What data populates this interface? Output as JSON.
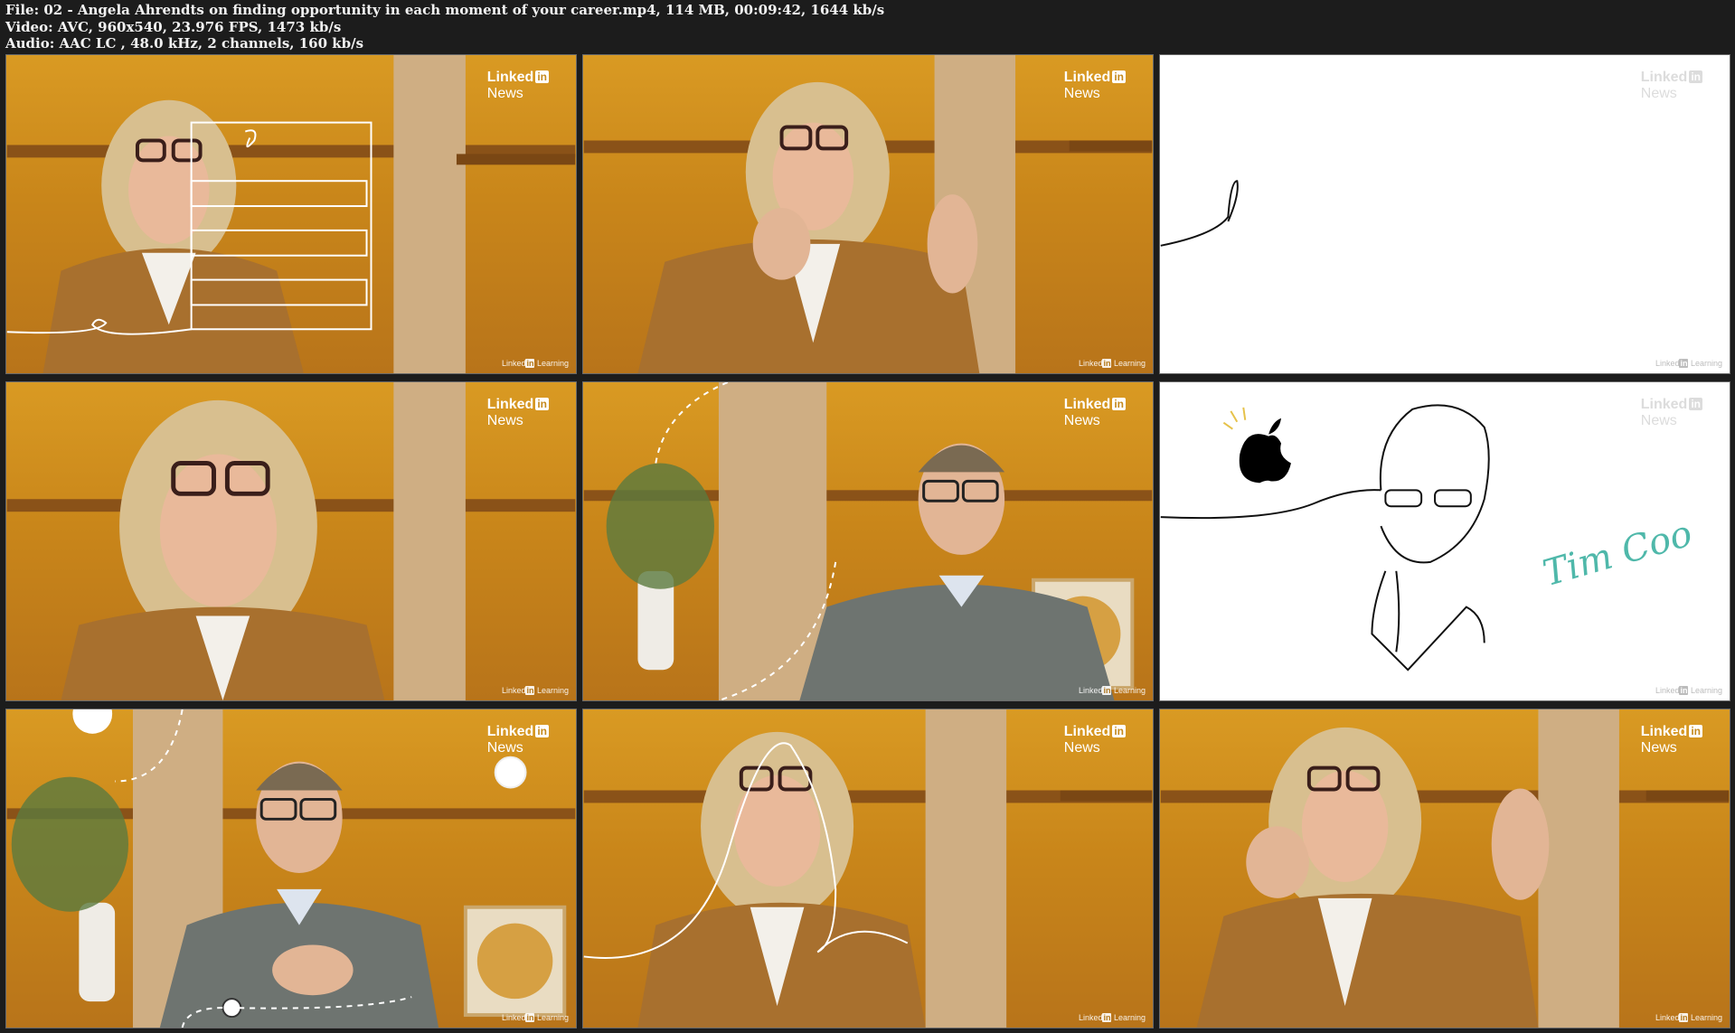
{
  "file_info": {
    "file_line": "File: 02 - Angela Ahrendts on finding opportunity in each moment of your career.mp4, 114 MB, 00:09:42, 1644 kb/s",
    "video_line": "Video: AVC, 960x540, 23.976 FPS, 1473 kb/s",
    "audio_line": "Audio: AAC LC , 48.0 kHz, 2 channels, 160 kb/s"
  },
  "brand": {
    "linked": "Linked",
    "in": "in",
    "news": "News",
    "learning_linked": "Linked",
    "learning_in": "in",
    "learning_word": " Learning"
  },
  "drawing": {
    "signature_text": "Tim Coo"
  },
  "colors": {
    "background": "#1c1c1c",
    "studio_wall": "#d99a23",
    "signature": "#4fb8aa"
  },
  "thumbnails": [
    {
      "scene": "woman-with-drawn-form-overlay"
    },
    {
      "scene": "woman-gesturing"
    },
    {
      "scene": "white-drawing-line"
    },
    {
      "scene": "woman-closeup"
    },
    {
      "scene": "man-speaking"
    },
    {
      "scene": "apple-logo-and-portrait-drawing"
    },
    {
      "scene": "man-gesturing"
    },
    {
      "scene": "woman-with-curve-overlay"
    },
    {
      "scene": "woman-raising-hands"
    }
  ]
}
